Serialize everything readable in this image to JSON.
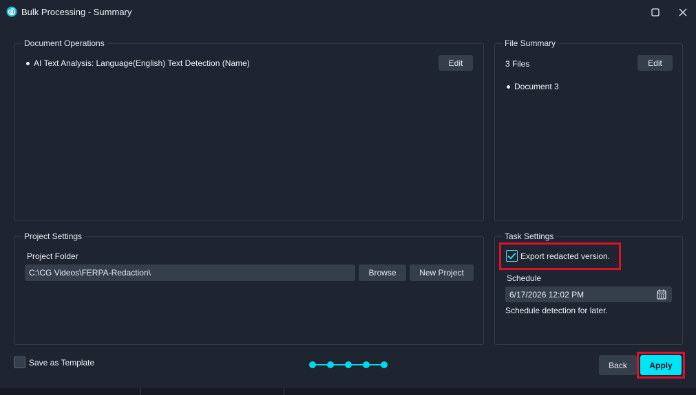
{
  "window": {
    "title": "Bulk Processing - Summary",
    "icon": "spiral-app-icon",
    "maximize_icon": "maximize-icon",
    "close_icon": "close-icon"
  },
  "document_operations": {
    "legend": "Document Operations",
    "items": [
      "AI Text Analysis: Language(English) Text Detection (Name)"
    ],
    "edit_label": "Edit"
  },
  "file_summary": {
    "legend": "File Summary",
    "count_text": "3 Files",
    "edit_label": "Edit",
    "files": [
      "Document 3"
    ]
  },
  "project_settings": {
    "legend": "Project Settings",
    "folder_label": "Project Folder",
    "folder_value": "C:\\CG Videos\\FERPA-Redaction\\",
    "browse_label": "Browse",
    "new_project_label": "New Project"
  },
  "task_settings": {
    "legend": "Task Settings",
    "export_label": "Export redacted version.",
    "export_checked": true,
    "schedule_label": "Schedule",
    "schedule_value": "6/17/2026 12:02 PM",
    "schedule_hint": "Schedule detection for later."
  },
  "footer": {
    "save_template_label": "Save as Template",
    "save_template_checked": false,
    "progress_steps": 5,
    "back_label": "Back",
    "apply_label": "Apply"
  },
  "colors": {
    "background": "#1e2530",
    "button": "#353e4b",
    "accent": "#00e5f5",
    "highlight": "#e0102c"
  }
}
